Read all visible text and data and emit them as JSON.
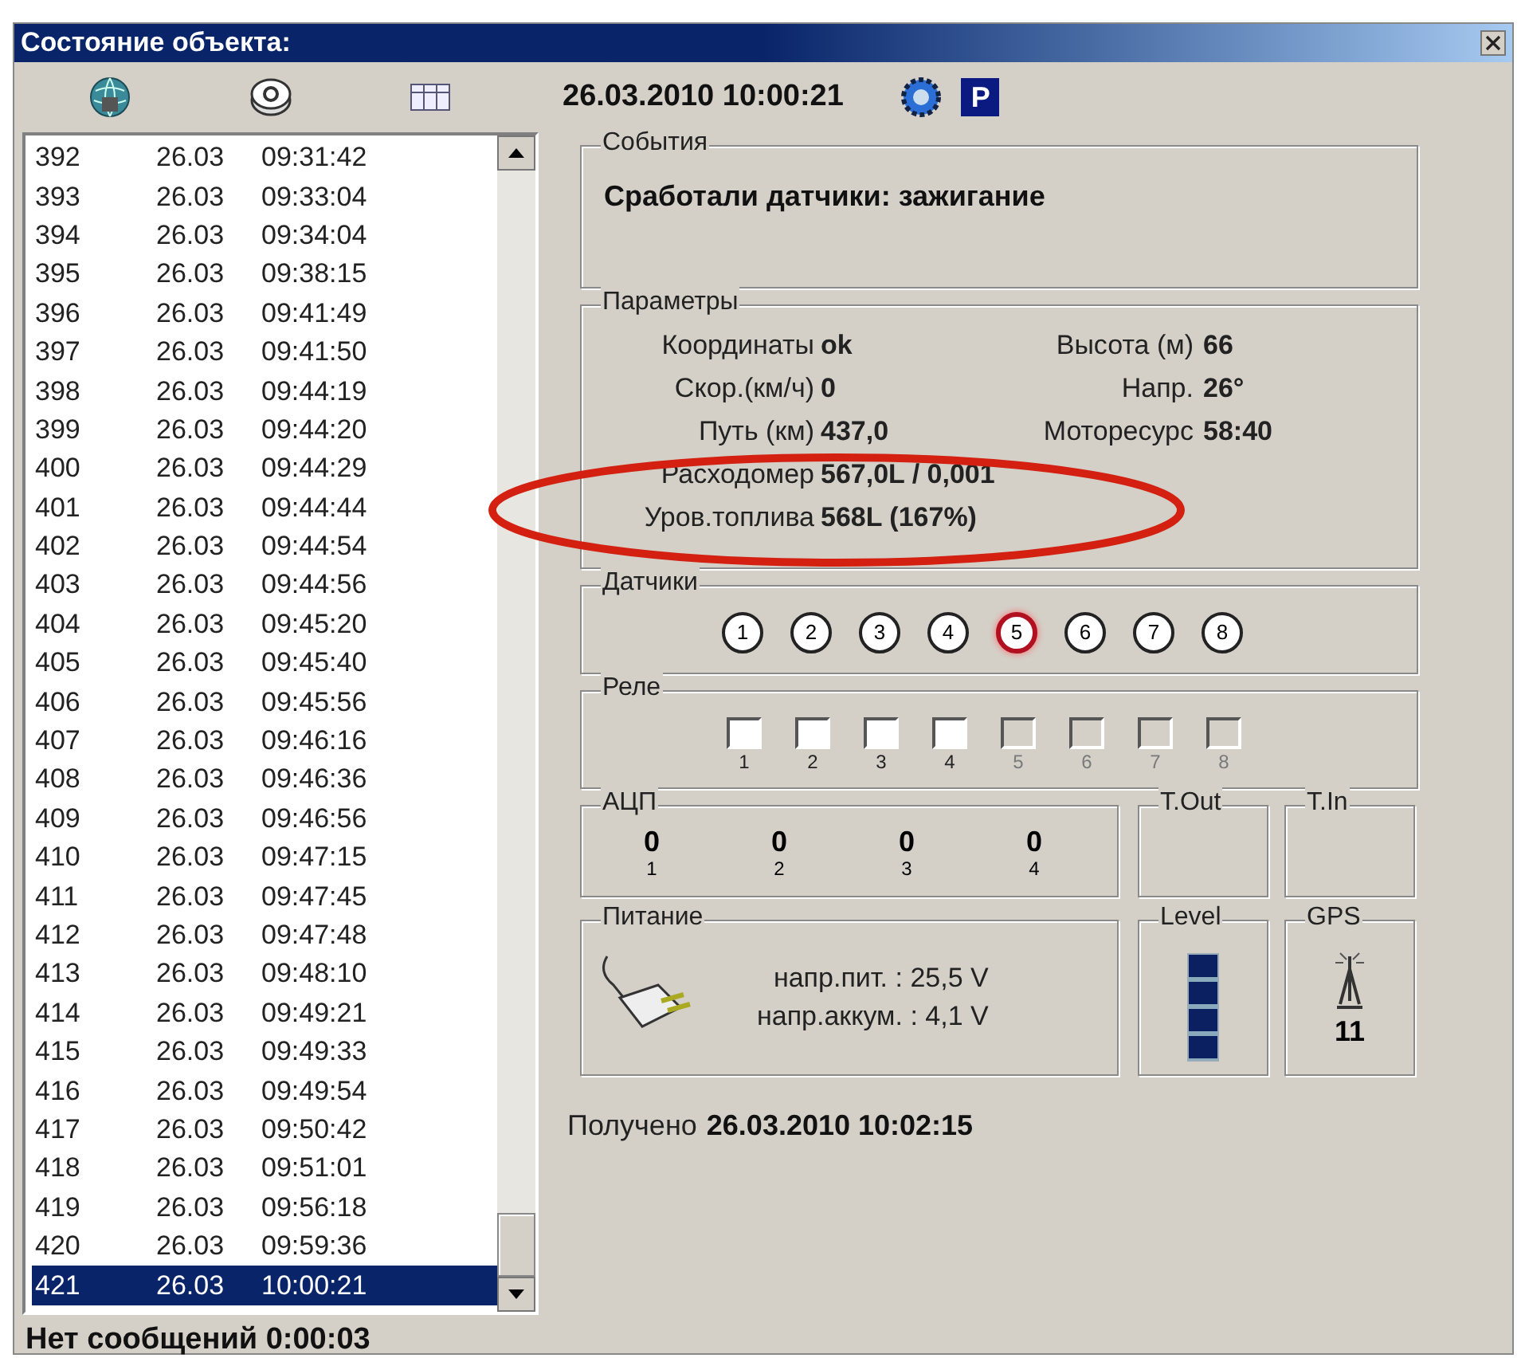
{
  "window": {
    "title": "Состояние объекта:"
  },
  "toolbar": {
    "datetime": "26.03.2010 10:00:21",
    "parking_badge": "P"
  },
  "messages": [
    {
      "number": "392",
      "date": "26.03",
      "time": "09:31:42",
      "selected": false
    },
    {
      "number": "393",
      "date": "26.03",
      "time": "09:33:04",
      "selected": false
    },
    {
      "number": "394",
      "date": "26.03",
      "time": "09:34:04",
      "selected": false
    },
    {
      "number": "395",
      "date": "26.03",
      "time": "09:38:15",
      "selected": false
    },
    {
      "number": "396",
      "date": "26.03",
      "time": "09:41:49",
      "selected": false
    },
    {
      "number": "397",
      "date": "26.03",
      "time": "09:41:50",
      "selected": false
    },
    {
      "number": "398",
      "date": "26.03",
      "time": "09:44:19",
      "selected": false
    },
    {
      "number": "399",
      "date": "26.03",
      "time": "09:44:20",
      "selected": false
    },
    {
      "number": "400",
      "date": "26.03",
      "time": "09:44:29",
      "selected": false
    },
    {
      "number": "401",
      "date": "26.03",
      "time": "09:44:44",
      "selected": false
    },
    {
      "number": "402",
      "date": "26.03",
      "time": "09:44:54",
      "selected": false
    },
    {
      "number": "403",
      "date": "26.03",
      "time": "09:44:56",
      "selected": false
    },
    {
      "number": "404",
      "date": "26.03",
      "time": "09:45:20",
      "selected": false
    },
    {
      "number": "405",
      "date": "26.03",
      "time": "09:45:40",
      "selected": false
    },
    {
      "number": "406",
      "date": "26.03",
      "time": "09:45:56",
      "selected": false
    },
    {
      "number": "407",
      "date": "26.03",
      "time": "09:46:16",
      "selected": false
    },
    {
      "number": "408",
      "date": "26.03",
      "time": "09:46:36",
      "selected": false
    },
    {
      "number": "409",
      "date": "26.03",
      "time": "09:46:56",
      "selected": false
    },
    {
      "number": "410",
      "date": "26.03",
      "time": "09:47:15",
      "selected": false
    },
    {
      "number": "411",
      "date": "26.03",
      "time": "09:47:45",
      "selected": false
    },
    {
      "number": "412",
      "date": "26.03",
      "time": "09:47:48",
      "selected": false
    },
    {
      "number": "413",
      "date": "26.03",
      "time": "09:48:10",
      "selected": false
    },
    {
      "number": "414",
      "date": "26.03",
      "time": "09:49:21",
      "selected": false
    },
    {
      "number": "415",
      "date": "26.03",
      "time": "09:49:33",
      "selected": false
    },
    {
      "number": "416",
      "date": "26.03",
      "time": "09:49:54",
      "selected": false
    },
    {
      "number": "417",
      "date": "26.03",
      "time": "09:50:42",
      "selected": false
    },
    {
      "number": "418",
      "date": "26.03",
      "time": "09:51:01",
      "selected": false
    },
    {
      "number": "419",
      "date": "26.03",
      "time": "09:56:18",
      "selected": false
    },
    {
      "number": "420",
      "date": "26.03",
      "time": "09:59:36",
      "selected": false
    },
    {
      "number": "421",
      "date": "26.03",
      "time": "10:00:21",
      "selected": true
    }
  ],
  "status": "Нет сообщений 0:00:03",
  "events": {
    "title": "События",
    "text": "Сработали датчики: зажигание"
  },
  "parameters": {
    "title": "Параметры",
    "left": [
      {
        "label": "Координаты",
        "value": "ok"
      },
      {
        "label": "Скор.(км/ч)",
        "value": "0"
      },
      {
        "label": "Путь (км)",
        "value": "437,0"
      },
      {
        "label": "Расходомер",
        "value": "567,0L / 0,001"
      },
      {
        "label": "Уров.топлива",
        "value": "568L (167%)"
      }
    ],
    "right": [
      {
        "label": "Высота (м)",
        "value": "66"
      },
      {
        "label": "Напр.",
        "value": "26°"
      },
      {
        "label": "Моторесурс",
        "value": "58:40"
      }
    ]
  },
  "sensors": {
    "title": "Датчики",
    "items": [
      {
        "label": "1",
        "on": false
      },
      {
        "label": "2",
        "on": false
      },
      {
        "label": "3",
        "on": false
      },
      {
        "label": "4",
        "on": false
      },
      {
        "label": "5",
        "on": true
      },
      {
        "label": "6",
        "on": false
      },
      {
        "label": "7",
        "on": false
      },
      {
        "label": "8",
        "on": false
      }
    ]
  },
  "relays": {
    "title": "Реле",
    "items": [
      {
        "label": "1",
        "disabled": false
      },
      {
        "label": "2",
        "disabled": false
      },
      {
        "label": "3",
        "disabled": false
      },
      {
        "label": "4",
        "disabled": false
      },
      {
        "label": "5",
        "disabled": true
      },
      {
        "label": "6",
        "disabled": true
      },
      {
        "label": "7",
        "disabled": true
      },
      {
        "label": "8",
        "disabled": true
      }
    ]
  },
  "adc": {
    "title": "АЦП",
    "channels": [
      {
        "value": "0",
        "label": "1"
      },
      {
        "value": "0",
        "label": "2"
      },
      {
        "value": "0",
        "label": "3"
      },
      {
        "value": "0",
        "label": "4"
      }
    ]
  },
  "t_out": {
    "title": "T.Out"
  },
  "t_in": {
    "title": "T.In"
  },
  "power": {
    "title": "Питание",
    "readings": [
      "напр.пит. : 25,5 V",
      "напр.аккум. : 4,1 V"
    ]
  },
  "level": {
    "title": "Level",
    "level": 1
  },
  "gps": {
    "title": "GPS",
    "satellites": "11"
  },
  "received": {
    "label": "Получено",
    "value": "26.03.2010 10:02:15"
  }
}
